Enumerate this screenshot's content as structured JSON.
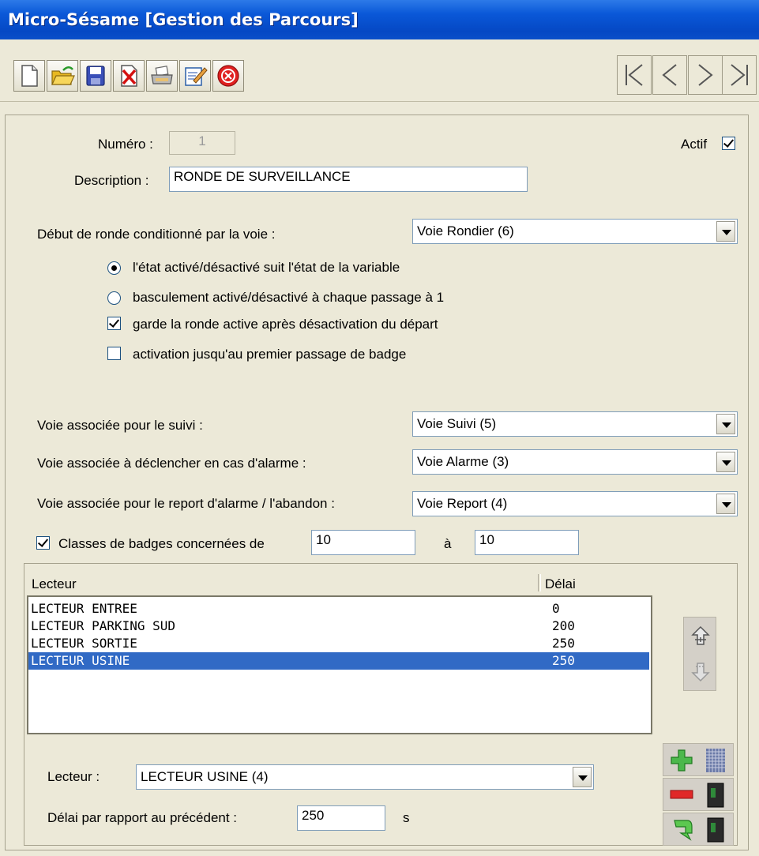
{
  "window": {
    "title": "Micro-Sésame [Gestion des Parcours]"
  },
  "toolbar": {
    "buttons": [
      "new-document-icon",
      "open-folder-icon",
      "save-disk-icon",
      "delete-icon",
      "print-icon",
      "edit-icon",
      "close-icon"
    ],
    "nav": [
      "first-record-icon",
      "previous-record-icon",
      "next-record-icon",
      "last-record-icon"
    ]
  },
  "form": {
    "numero_label": "Numéro :",
    "numero_value": "1",
    "actif_label": "Actif",
    "actif_checked": true,
    "description_label": "Description :",
    "description_value": "RONDE DE SURVEILLANCE",
    "debut_label": "Début de ronde conditionné par la voie :",
    "debut_value": "Voie Rondier (6)",
    "radio1_label": "l'état activé/désactivé suit l'état de la variable",
    "radio1_selected": true,
    "radio2_label": "basculement activé/désactivé à chaque passage à 1",
    "check1_label": "garde la ronde active après désactivation du départ",
    "check1_checked": true,
    "check2_label": "activation jusqu'au premier passage de badge",
    "check2_checked": false,
    "suivi_label": "Voie associée pour le suivi :",
    "suivi_value": "Voie Suivi (5)",
    "alarme_label": "Voie associée à déclencher en cas d'alarme :",
    "alarme_value": "Voie Alarme (3)",
    "report_label": "Voie associée pour le report d'alarme / l'abandon :",
    "report_value": "Voie Report (4)",
    "classes_label": "Classes de badges concernées de",
    "classes_checked": true,
    "classes_from": "10",
    "classes_to_label": "à",
    "classes_to": "10"
  },
  "readers": {
    "col_lecteur": "Lecteur",
    "col_delai": "Délai",
    "rows": [
      {
        "name": "LECTEUR ENTREE",
        "delay": "0",
        "selected": false
      },
      {
        "name": "LECTEUR PARKING SUD",
        "delay": "200",
        "selected": false
      },
      {
        "name": "LECTEUR SORTIE",
        "delay": "250",
        "selected": false
      },
      {
        "name": "LECTEUR USINE",
        "delay": "250",
        "selected": true
      }
    ],
    "lecteur_label": "Lecteur :",
    "lecteur_value": "LECTEUR USINE (4)",
    "delai_label": "Délai par rapport au précédent :",
    "delai_value": "250",
    "delai_unit": "s"
  },
  "colors": {
    "selection": "#316ac5",
    "titlebar": "#0a58d8",
    "window_bg": "#ece9d8"
  }
}
